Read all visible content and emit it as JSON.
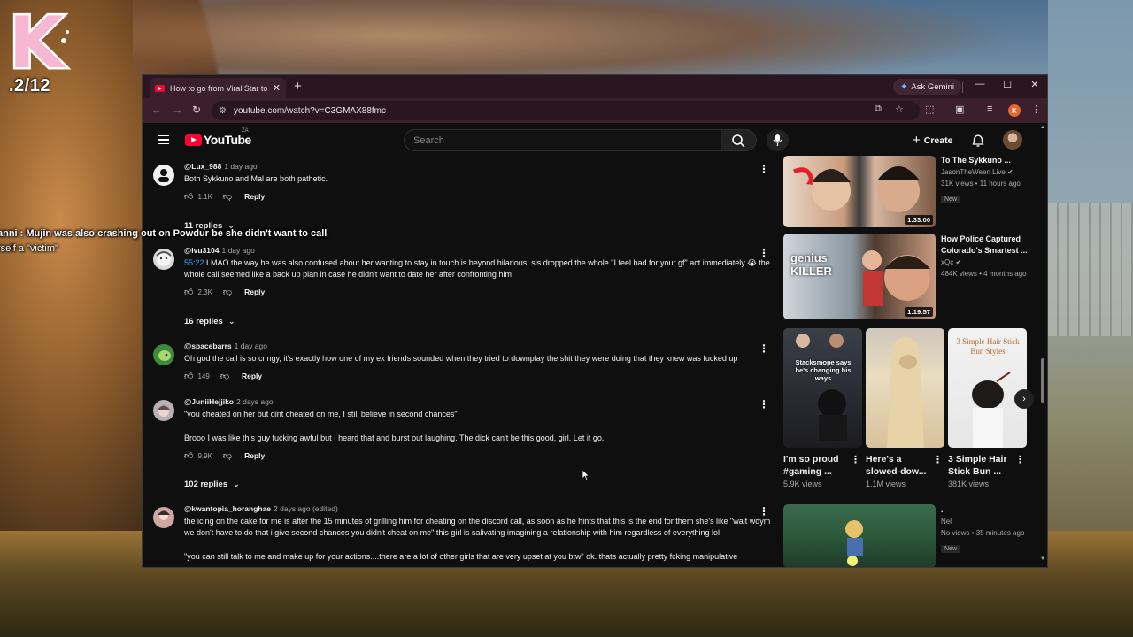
{
  "overlay": {
    "counter": ".2/12",
    "chat_line_1": "anni : Mujin was also crashing out on Powdur be she didn't want to call",
    "chat_line_2": "rself a \"victim\""
  },
  "browser": {
    "tab_title": "How to go from Viral Star to Se",
    "gemini_label": "Ask Gemini",
    "url": "youtube.com/watch?v=C3GMAX88fmc",
    "profile_initial": "K"
  },
  "youtube": {
    "wordmark": "YouTube",
    "country": "ZA",
    "search_placeholder": "Search",
    "create_label": "Create",
    "comments": [
      {
        "author": "@Lux_988",
        "time": "1 day ago",
        "text": "Both Sykkuno and Mal are both pathetic.",
        "likes": "1.1K",
        "reply_label": "Reply",
        "avatar_color": "#f1f1f1"
      },
      {
        "author": "@ivu3104",
        "time": "1 day ago",
        "timestamp": "55:22",
        "text": " LMAO the way he was also confused about her wanting to stay in touch is beyond hilarious, sis dropped the whole \"I feel bad for your gf\" act immediately 😭 the whole call seemed like a back up plan in case he didn't want to date her after confronting him",
        "likes": "2.3K",
        "reply_label": "Reply",
        "avatar_color": "#d9d9d9"
      },
      {
        "author": "@spacebarrs",
        "time": "1 day ago",
        "text": "Oh god the call is so cringy, it's exactly how one of my ex friends sounded when they tried to downplay the shit they were doing that they knew was fucked up",
        "likes": "149",
        "reply_label": "Reply",
        "avatar_color": "#3d8a3d"
      },
      {
        "author": "@JuniiHejjiko",
        "time": "2 days ago",
        "text": "\"you cheated on her but dint cheated on me, I still believe in second chances\"",
        "text2": "Brooo I was like this guy fucking awful but I heard that and burst out laughing. The dick can't be this good, girl. Let it go.",
        "likes": "9.9K",
        "reply_label": "Reply",
        "avatar_color": "#b9b0b4"
      },
      {
        "author": "@kwantopia_horanghae",
        "time": "2 days ago (edited)",
        "text": "the icing on the cake for me is after the 15 minutes of grilling him for cheating on the discord call, as soon as he hints that this is the end for them she's like \"wait wdym we don't have to do that i give second chances you didn't cheat on me\" this girl is salivating imagining a relationship with him regardless of everything lol",
        "text2": "\"you can still talk to me and make up for your actions....there are a lot of other girls that are very upset at you btw\" ok. thats actually pretty fcking manipulative",
        "avatar_color": "#cfa6a0"
      }
    ],
    "replies": [
      {
        "label": "11 replies"
      },
      {
        "label": "16 replies"
      },
      {
        "label": "102 replies"
      }
    ],
    "sidebar": {
      "videos": [
        {
          "title": "To The Sykkuno ...",
          "channel": "JasonTheWeen Live",
          "stats": "31K views • 11 hours ago",
          "badge": "New",
          "duration": "1:33:00"
        },
        {
          "title": "How Police Captured Colorado's Smartest ...",
          "channel": "xQc",
          "stats": "484K views • 4 months ago",
          "duration": "1:19:57",
          "thumb_text": "genius KILLER"
        },
        {
          "title": ".",
          "channel": "Nel",
          "stats": "No views • 35 minutes ago",
          "badge": "New"
        }
      ],
      "shorts": [
        {
          "title": "I'm so proud #gaming ...",
          "views": "5.9K views",
          "thumb_text": "Stacksmope says he's changing his ways"
        },
        {
          "title": "Here's a slowed-dow...",
          "views": "1.1M views"
        },
        {
          "title": "3 Simple Hair Stick Bun ...",
          "views": "381K views",
          "thumb_text": "3 Simple Hair Stick Bun Styles"
        }
      ]
    }
  }
}
